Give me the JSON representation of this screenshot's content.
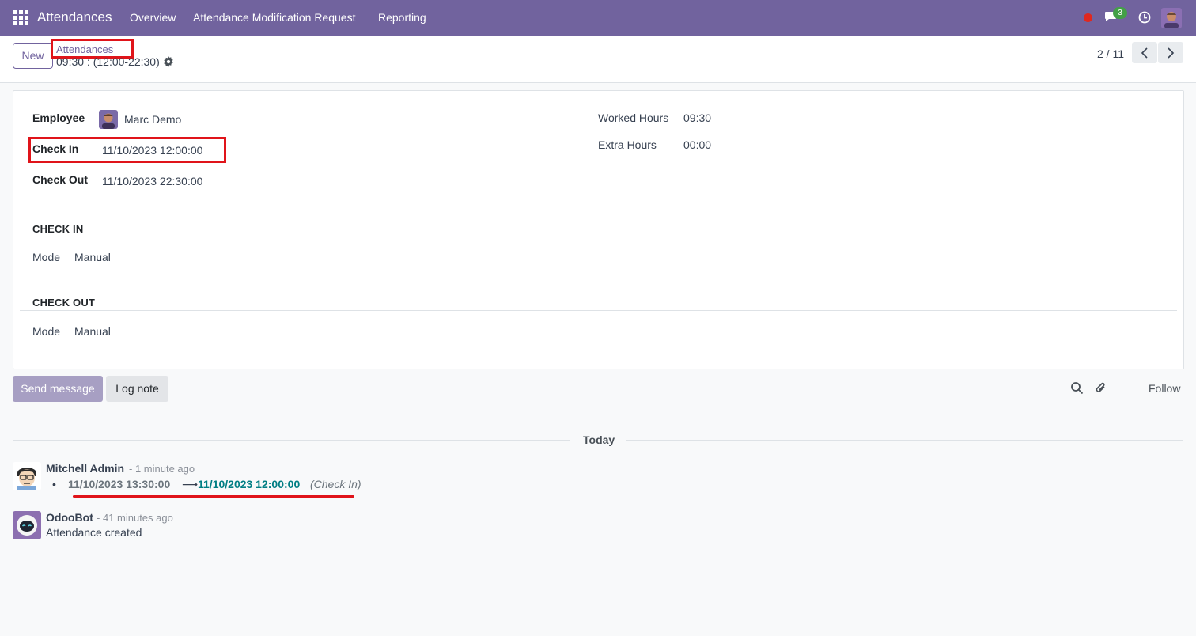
{
  "navbar": {
    "brand": "Attendances",
    "items": [
      "Overview",
      "Attendance Modification Request",
      "Reporting"
    ],
    "chat_count": "3"
  },
  "control": {
    "new_label": "New",
    "breadcrumb": "Attendances",
    "record_title": "09:30 : (12:00-22:30)",
    "pager": "2 / 11"
  },
  "form": {
    "employee_label": "Employee",
    "employee_value": "Marc Demo",
    "check_in_label": "Check In",
    "check_in_value": "11/10/2023 12:00:00",
    "check_out_label": "Check Out",
    "check_out_value": "11/10/2023 22:30:00",
    "worked_hours_label": "Worked Hours",
    "worked_hours_value": "09:30",
    "extra_hours_label": "Extra Hours",
    "extra_hours_value": "00:00",
    "section_check_in": "CHECK IN",
    "section_check_out": "CHECK OUT",
    "mode_label": "Mode",
    "mode_in_value": "Manual",
    "mode_out_value": "Manual"
  },
  "chatter": {
    "send_message": "Send message",
    "log_note": "Log note",
    "follow": "Follow",
    "day_separator": "Today",
    "messages": [
      {
        "author": "Mitchell Admin",
        "date": "- 1 minute ago",
        "tracking": {
          "old": "11/10/2023 13:30:00",
          "arrow": "⟶",
          "new": "11/10/2023 12:00:00",
          "field": "(Check In)"
        }
      },
      {
        "author": "OdooBot",
        "date": "- 41 minutes ago",
        "body": "Attendance created"
      }
    ]
  },
  "colors": {
    "brand": "#71639e",
    "highlight": "#e0141a",
    "tracking_new": "#017e84"
  }
}
